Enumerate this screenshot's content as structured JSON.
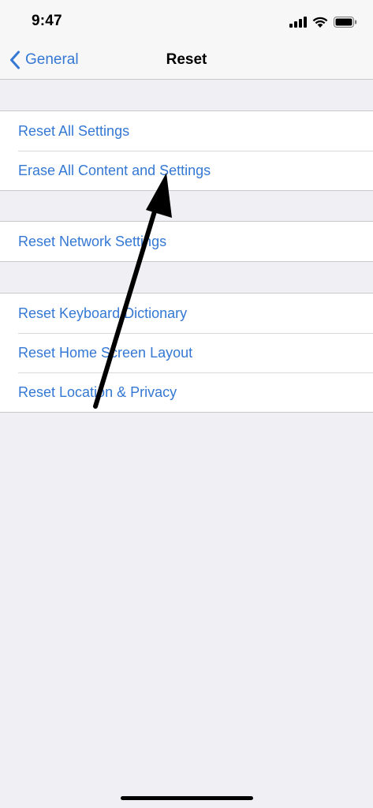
{
  "status_bar": {
    "time": "9:47",
    "icons": [
      "cellular-signal-icon",
      "wifi-icon",
      "battery-icon"
    ]
  },
  "nav": {
    "back_label": "General",
    "back_icon": "chevron-left-icon",
    "title": "Reset"
  },
  "groups": [
    {
      "items": [
        {
          "label": "Reset All Settings"
        },
        {
          "label": "Erase All Content and Settings"
        }
      ]
    },
    {
      "items": [
        {
          "label": "Reset Network Settings"
        }
      ]
    },
    {
      "items": [
        {
          "label": "Reset Keyboard Dictionary"
        },
        {
          "label": "Reset Home Screen Layout"
        },
        {
          "label": "Reset Location & Privacy"
        }
      ]
    }
  ],
  "annotation": {
    "type": "arrow-icon",
    "color": "#000000",
    "points_to": "Erase All Content and Settings"
  },
  "colors": {
    "accent": "#3478d4",
    "background": "#efeff4",
    "bar": "#f7f7f7"
  }
}
